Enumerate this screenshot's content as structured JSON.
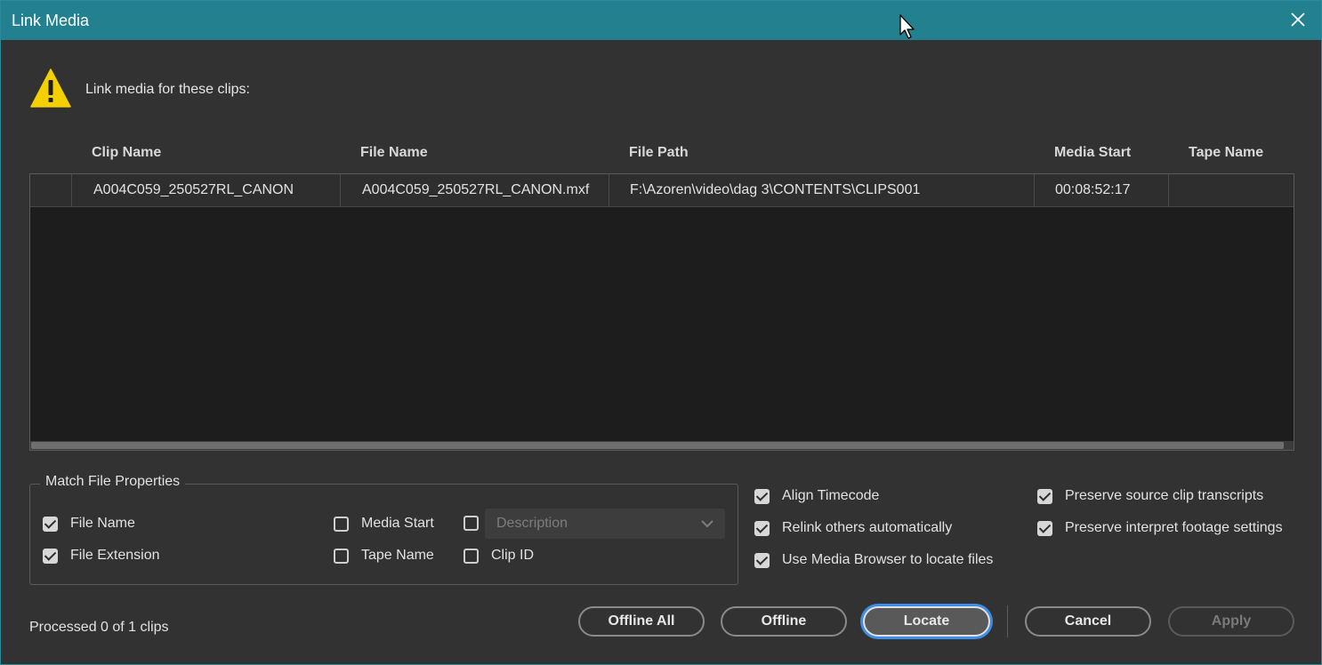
{
  "window": {
    "title": "Link Media",
    "close_label": "×"
  },
  "prompt": "Link media for these clips:",
  "table": {
    "columns": [
      "Clip Name",
      "File Name",
      "File Path",
      "Media Start",
      "Tape Name"
    ],
    "rows": [
      {
        "clip_name": "A004C059_250527RL_CANON",
        "file_name": "A004C059_250527RL_CANON.mxf",
        "file_path": "F:\\Azoren\\video\\dag 3\\CONTENTS\\CLIPS001",
        "media_start": "00:08:52:17",
        "tape_name": ""
      }
    ]
  },
  "match_group": {
    "title": "Match File Properties",
    "options": [
      {
        "label": "File Name",
        "checked": true
      },
      {
        "label": "File Extension",
        "checked": true
      },
      {
        "label": "Media Start",
        "checked": false
      },
      {
        "label": "Tape Name",
        "checked": false
      },
      {
        "label": "",
        "checked": false
      },
      {
        "label": "Clip ID",
        "checked": false
      }
    ],
    "description_placeholder": "Description"
  },
  "options": [
    {
      "label": "Align Timecode",
      "checked": true
    },
    {
      "label": "Relink others automatically",
      "checked": true
    },
    {
      "label": "Use Media Browser to locate files",
      "checked": true
    },
    {
      "label": "Preserve source clip transcripts",
      "checked": true
    },
    {
      "label": "Preserve interpret footage settings",
      "checked": true
    }
  ],
  "status": "Processed 0 of 1 clips",
  "buttons": {
    "offline_all": "Offline All",
    "offline": "Offline",
    "locate": "Locate",
    "cancel": "Cancel",
    "apply": "Apply"
  },
  "colors": {
    "titlebar": "#23808f",
    "focus_ring": "#3d8ce6",
    "warning": "#f5d000"
  }
}
